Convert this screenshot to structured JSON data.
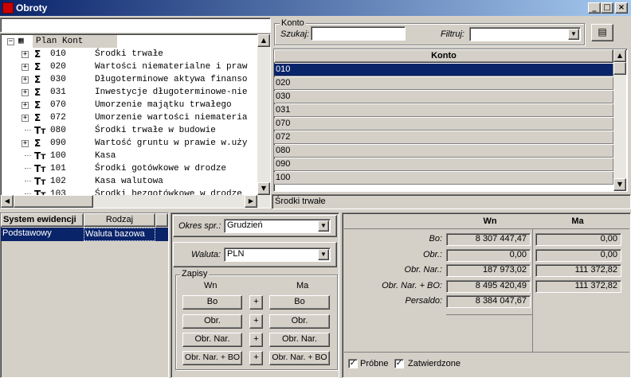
{
  "window": {
    "title": "Obroty"
  },
  "tree": {
    "root_label": "Plan Kont",
    "items": [
      {
        "code": "010",
        "name": "Środki trwałe",
        "icon": "sigma-icon",
        "expandable": true
      },
      {
        "code": "020",
        "name": "Wartości niematerialne i praw",
        "icon": "sigma-icon",
        "expandable": true
      },
      {
        "code": "030",
        "name": "Długoterminowe aktywa finanso",
        "icon": "sigma-icon",
        "expandable": true
      },
      {
        "code": "031",
        "name": "Inwestycje długoterminowe-nie",
        "icon": "sigma-icon",
        "expandable": true
      },
      {
        "code": "070",
        "name": "Umorzenie majątku trwałego",
        "icon": "sigma-icon",
        "expandable": true
      },
      {
        "code": "072",
        "name": "Umorzenie wartości niemateria",
        "icon": "sigma-icon",
        "expandable": true
      },
      {
        "code": "080",
        "name": "Środki trwałe w budowie",
        "icon": "account-t-icon",
        "expandable": false
      },
      {
        "code": "090",
        "name": "Wartość gruntu w prawie w.uży",
        "icon": "sigma-icon",
        "expandable": true
      },
      {
        "code": "100",
        "name": "Kasa",
        "icon": "account-t-icon",
        "expandable": false
      },
      {
        "code": "101",
        "name": "Środki gotówkowe w drodze",
        "icon": "account-t-icon",
        "expandable": false
      },
      {
        "code": "102",
        "name": "Kasa walutowa",
        "icon": "account-t-icon",
        "expandable": false
      },
      {
        "code": "103",
        "name": "Środki bezgotówkowe w drodze",
        "icon": "account-t-icon",
        "expandable": false
      }
    ]
  },
  "konto": {
    "group_label": "Konto",
    "szukaj_label": "Szukaj:",
    "szukaj_value": "",
    "filtruj_label": "Filtruj:",
    "filtruj_value": "",
    "column_header": "Konto",
    "rows": [
      "010",
      "020",
      "030",
      "031",
      "070",
      "072",
      "080",
      "090",
      "100"
    ],
    "selected_index": 0,
    "status": "Środki trwałe"
  },
  "system_table": {
    "headers": [
      "System ewidencji",
      "Rodzaj"
    ],
    "rows": [
      [
        "Podstawowy",
        "Waluta bazowa"
      ]
    ]
  },
  "okres": {
    "label": "Okres spr.:",
    "value": "Grudzień"
  },
  "waluta": {
    "label": "Waluta:",
    "value": "PLN"
  },
  "zapisy": {
    "label": "Zapisy",
    "wn_label": "Wn",
    "ma_label": "Ma",
    "buttons": [
      "Bo",
      "Obr.",
      "Obr. Nar.",
      "Obr. Nar. + BO"
    ],
    "plus": "+"
  },
  "values": {
    "wn_header": "Wn",
    "ma_header": "Ma",
    "rows": [
      {
        "label": "Bo:",
        "wn": "8 307 447,47",
        "ma": "0,00"
      },
      {
        "label": "Obr.:",
        "wn": "0,00",
        "ma": "0,00"
      },
      {
        "label": "Obr. Nar.:",
        "wn": "187 973,02",
        "ma": "111 372,82"
      },
      {
        "label": "Obr. Nar. + BO:",
        "wn": "8 495 420,49",
        "ma": "111 372,82"
      },
      {
        "label": "Persaldo:",
        "wn": "8 384 047,67",
        "ma": ""
      }
    ]
  },
  "checks": {
    "probne": "Próbne",
    "zatwierdzone": "Zatwierdzone",
    "probne_checked": true,
    "zatwierdzone_checked": true
  },
  "colors": {
    "title_start": "#0a246a",
    "title_end": "#a6caf0",
    "selection": "#0a246a",
    "face": "#d4d0c8"
  }
}
